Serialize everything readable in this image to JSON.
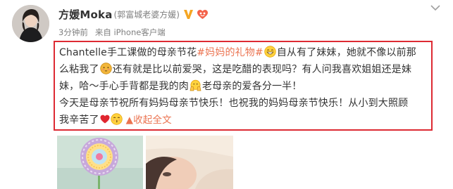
{
  "user": {
    "name": "方媛Moka",
    "remark": "(郭富城老婆方媛)"
  },
  "meta": {
    "time": "3分钟前",
    "source": "来自 iPhone客户端"
  },
  "post": {
    "line1_a": "Chantelle手工课做的母亲节花",
    "hashtag": "#妈妈的礼物#",
    "line1_b": "自从有了妹妹，她就不像以前那",
    "line2_a": "么粘我了",
    "line2_b": "还有就是比以前爱哭，这是吃醋的表现吗？有人问我喜欢姐姐还是妹",
    "line3_a": "妹，哈～手心手背都是我的肉",
    "line3_b": "老母亲的爱各分一半！",
    "line4": "今天是母亲节祝所有妈妈母亲节快乐！也祝我的妈妈母亲节快乐！从小到大照顾",
    "line5": "我辛苦了",
    "collapse": "收起全文"
  },
  "icons": {
    "verified": "verified-v-badge-icon",
    "level": "member-level-badge-icon",
    "more": "chevron-down-icon",
    "emoji_1": "grinning-emoji-icon",
    "emoji_2": "shy-emoji-icon",
    "emoji_3": "hands-emoji-icon",
    "emoji_4": "heart-icon",
    "emoji_5": "kissing-emoji-icon",
    "collapse": "collapse-arrow-icon"
  },
  "colors": {
    "highlight_border": "#dd2a33",
    "link": "#eb7350",
    "verified": "#f5a623",
    "text": "#333333",
    "meta": "#808080"
  }
}
